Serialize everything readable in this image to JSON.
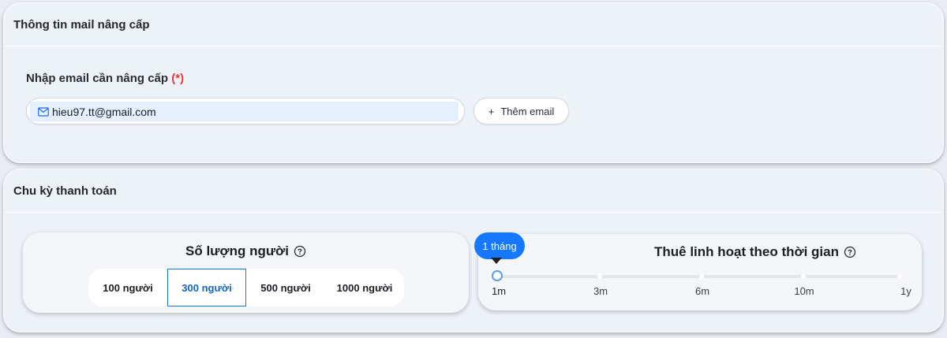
{
  "email_card": {
    "title": "Thông tin mail nâng cấp",
    "field_label": "Nhập email cần nâng cấp",
    "required_mark": "(*)",
    "email_value": "hieu97.tt@gmail.com",
    "add_button_icon": "+",
    "add_button_label": "Thêm email"
  },
  "billing_card": {
    "title": "Chu kỳ thanh toán",
    "users_panel": {
      "title": "Số lượng người",
      "options": [
        "100 người",
        "300 người",
        "500 người",
        "1000 người"
      ],
      "selected": "300 người"
    },
    "rental_panel": {
      "title": "Thuê linh hoạt theo thời gian",
      "tooltip": "1 tháng",
      "ticks": [
        "1m",
        "3m",
        "6m",
        "10m",
        "1y"
      ],
      "selected_tick": "1m"
    }
  },
  "colors": {
    "accent": "#1677ff",
    "required": "#e53935",
    "selected_border": "#1976d2"
  },
  "icons": {
    "email_prefix": "mail-icon",
    "help": "help-circle-icon"
  }
}
